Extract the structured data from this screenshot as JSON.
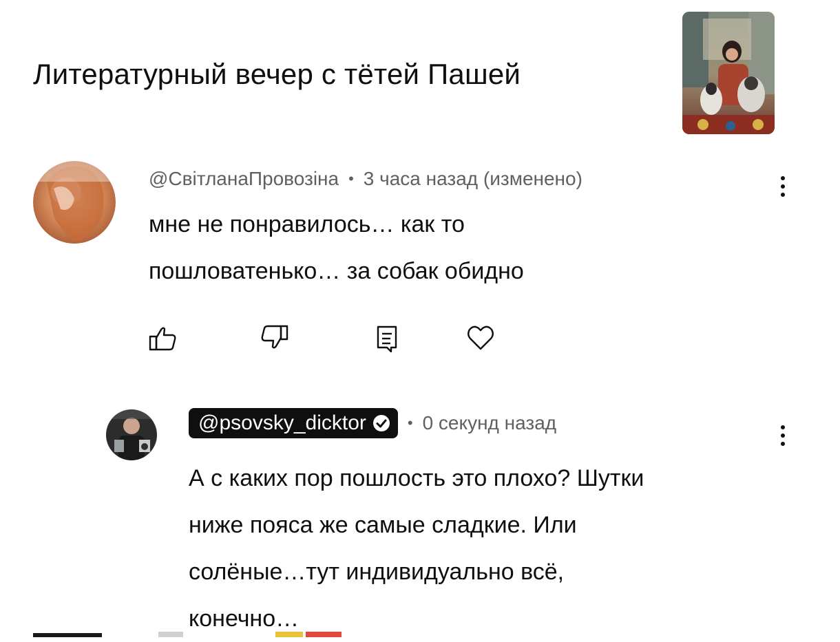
{
  "video": {
    "title": "Литературный вечер с тётей Пашей"
  },
  "comments": [
    {
      "author": "@СвітланаПровозіна",
      "separator": "•",
      "time": "3 часа назад (изменено)",
      "lines": [
        "мне не понравилось… как то",
        "пошловатенько… за собак обидно"
      ],
      "actions": [
        "like-icon",
        "dislike-icon",
        "reply-icon",
        "heart-icon"
      ]
    },
    {
      "author": "@psovsky_dicktor",
      "separator": "•",
      "time": "0 секунд назад",
      "verified": true,
      "lines": [
        "А с каких пор пошлость это плохо? Шутки",
        "ниже пояса же самые сладкие. Или",
        "солёные…тут индивидуально всё,",
        "конечно…"
      ]
    }
  ],
  "colors": {
    "text": "#0f0f0f",
    "meta": "#606060",
    "chip_bg": "#0f0f0f",
    "background": "#ffffff"
  }
}
